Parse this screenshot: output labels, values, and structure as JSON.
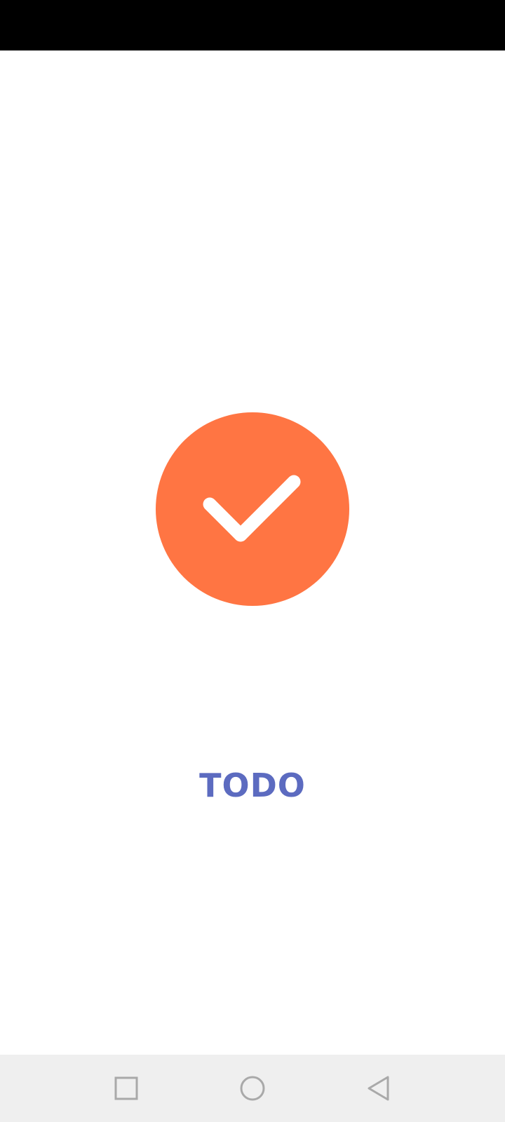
{
  "app": {
    "name": "TODO",
    "logo_icon": "check-icon",
    "colors": {
      "logo_background": "#FF7543",
      "logo_check": "#FFFFFF",
      "app_name_text": "#5C6BC0",
      "status_bar": "#000000",
      "nav_bar": "#EFEFEF",
      "nav_icons": "#A9A9A9"
    }
  },
  "navigation_bar": {
    "buttons": [
      {
        "name": "recents",
        "icon": "square-icon"
      },
      {
        "name": "home",
        "icon": "circle-icon"
      },
      {
        "name": "back",
        "icon": "triangle-back-icon"
      }
    ]
  }
}
